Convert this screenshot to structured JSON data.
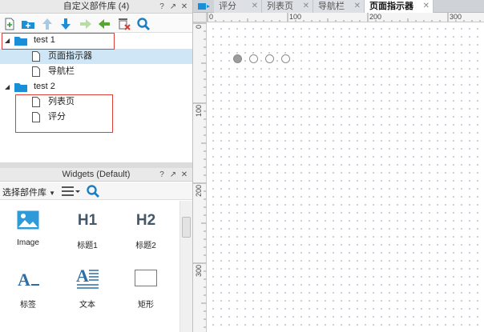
{
  "custom_library": {
    "title": "自定义部件库 (4)",
    "controls": [
      "?",
      "↗",
      "✕"
    ],
    "toolbar_icons": [
      "add-page-icon",
      "add-folder-icon",
      "move-up-icon",
      "move-down-icon",
      "indent-icon",
      "outdent-icon",
      "delete-page-icon",
      "search-icon"
    ],
    "tree": [
      {
        "label": "test 1",
        "toggle": "◢"
      },
      {
        "label": "页面指示器",
        "selected": true
      },
      {
        "label": "导航栏"
      },
      {
        "label": "test 2",
        "toggle": "◢"
      },
      {
        "label": "列表页"
      },
      {
        "label": "评分"
      }
    ]
  },
  "widgets_panel": {
    "title": "Widgets (Default)",
    "controls": [
      "?",
      "↗",
      "✕"
    ],
    "select_label": "选择部件库",
    "items": [
      {
        "label": "Image",
        "icon": "image-icon"
      },
      {
        "label": "标题1",
        "glyph": "H1"
      },
      {
        "label": "标题2",
        "glyph": "H2"
      },
      {
        "label": "标签",
        "icon": "label-icon"
      },
      {
        "label": "文本",
        "icon": "text-icon"
      },
      {
        "label": "矩形",
        "icon": "rectangle-icon"
      }
    ]
  },
  "tabs": [
    {
      "label": "评分"
    },
    {
      "label": "列表页"
    },
    {
      "label": "导航栏"
    },
    {
      "label": "页面指示器",
      "active": true
    }
  ],
  "ruler": {
    "h_labels": [
      "0",
      "100",
      "200",
      "300"
    ],
    "v_labels": [
      "0",
      "100",
      "200",
      "300"
    ]
  },
  "page_indicator": {
    "count": 4,
    "active_index": 0
  },
  "colors": {
    "selection": "#cfe6f7",
    "accent": "#1a8fd7",
    "highlight_box": "#e0403a"
  }
}
